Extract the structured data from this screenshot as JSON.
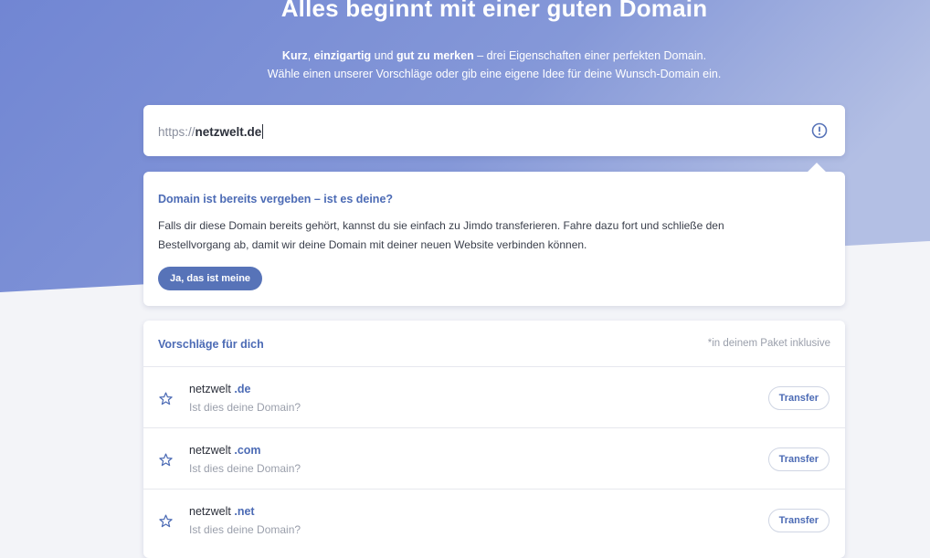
{
  "hero": {
    "title": "Alles beginnt mit einer guten Domain",
    "subtitle_bold_1": "Kurz",
    "subtitle_sep_1": ", ",
    "subtitle_bold_2": "einzigartig",
    "subtitle_sep_2": " und ",
    "subtitle_bold_3": "gut zu merken",
    "subtitle_rest": " – drei Eigenschaften einer perfekten Domain.",
    "subtitle_line2": "Wähle einen unserer Vorschläge oder gib eine eigene Idee für deine Wunsch-Domain ein."
  },
  "url_input": {
    "prefix": "https://",
    "value": "netzwelt.de",
    "icon": "exclamation-circle-icon"
  },
  "info": {
    "title": "Domain ist bereits vergeben – ist es deine?",
    "text": "Falls dir diese Domain bereits gehört, kannst du sie einfach zu Jimdo transferieren. Fahre dazu fort und schließe den Bestellvorgang ab, damit wir deine Domain mit deiner neuen Website verbinden können.",
    "button": "Ja, das ist meine"
  },
  "suggestions": {
    "title": "Vorschläge für dich",
    "note": "*in deinem Paket inklusive",
    "items": [
      {
        "name": "netzwelt ",
        "tld": ".de",
        "hint": "Ist dies deine Domain?",
        "button": "Transfer"
      },
      {
        "name": "netzwelt ",
        "tld": ".com",
        "hint": "Ist dies deine Domain?",
        "button": "Transfer"
      },
      {
        "name": "netzwelt ",
        "tld": ".net",
        "hint": "Ist dies deine Domain?",
        "button": "Transfer"
      }
    ]
  },
  "colors": {
    "hero_bg": "#7b8fd6",
    "accent": "#4c6bb5",
    "button": "#5773b8"
  }
}
